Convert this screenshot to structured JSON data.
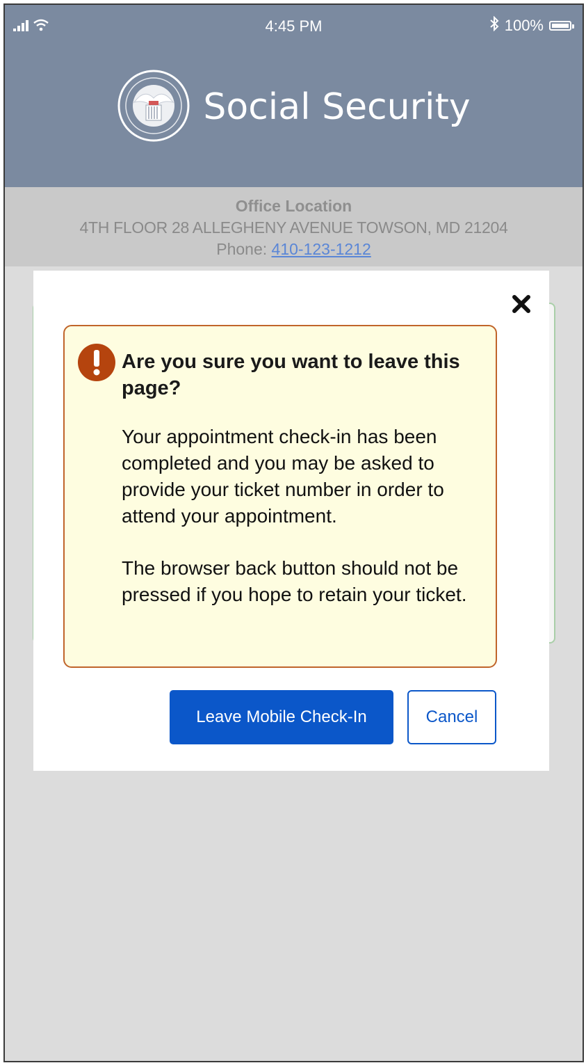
{
  "status_bar": {
    "time": "4:45 PM",
    "battery_percent": "100%",
    "icons": [
      "signal-icon",
      "wifi-icon",
      "bluetooth-icon",
      "battery-icon"
    ]
  },
  "header": {
    "title": "Social Security",
    "logo": "ssa-seal-icon"
  },
  "office": {
    "label": "Office Location",
    "address": "4TH FLOOR 28 ALLEGHENY AVENUE TOWSON, MD 21204",
    "phone_label": "Phone:",
    "phone_number": "410-123-1212"
  },
  "modal": {
    "close_icon": "close-icon",
    "alert_icon": "exclamation-icon",
    "title": "Are you sure you want to leave this page?",
    "paragraph1": "Your appointment check-in has been completed and you may be asked to provide your ticket number in order to attend your appointment.",
    "paragraph2": "The browser back button should not be pressed if you hope to retain your ticket.",
    "primary_button": "Leave Mobile Check-In",
    "secondary_button": "Cancel"
  },
  "colors": {
    "header_bg": "#7b8aa0",
    "alert_bg": "#fefde0",
    "alert_border": "#c0642a",
    "alert_icon": "#b5440e",
    "primary": "#0b57c9"
  }
}
